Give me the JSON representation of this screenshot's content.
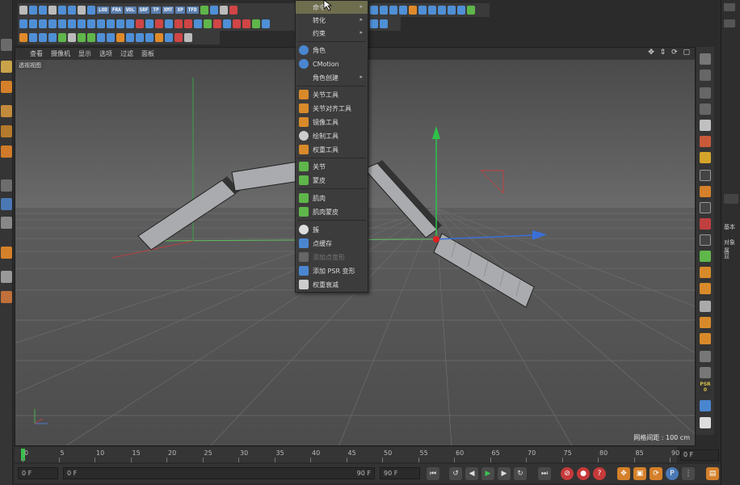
{
  "viewport": {
    "menu": [
      "查看",
      "摄像机",
      "显示",
      "选项",
      "过滤",
      "面板"
    ],
    "label": "透视视图",
    "grid_spacing": "网格间距 : 100 cm",
    "nav_icons": "✥ ⇕ ⟳ ▢"
  },
  "menu": {
    "items": [
      {
        "label": "命令",
        "icon": "none",
        "arrow": "▸",
        "state": "highlighted"
      },
      {
        "label": "转化",
        "icon": "none",
        "arrow": "▸"
      },
      {
        "label": "约束",
        "icon": "none",
        "arrow": "▸"
      },
      {
        "label": "角色",
        "icon": "character-icon",
        "color": "#4a86d0"
      },
      {
        "label": "CMotion",
        "icon": "cmotion-icon",
        "color": "#4a86d0"
      },
      {
        "label": "角色创建",
        "icon": "none",
        "arrow": "▸"
      },
      {
        "label": "关节工具",
        "icon": "joint-tool-icon",
        "color": "#d88a2a"
      },
      {
        "label": "关节对齐工具",
        "icon": "joint-align-icon",
        "color": "#d88a2a"
      },
      {
        "label": "镜像工具",
        "icon": "mirror-tool-icon",
        "color": "#d88a2a"
      },
      {
        "label": "绘制工具",
        "icon": "paint-tool-icon",
        "color": "#cccccc"
      },
      {
        "label": "权重工具",
        "icon": "weight-tool-icon",
        "color": "#d88a2a"
      },
      {
        "label": "关节",
        "icon": "joint-icon",
        "color": "#5fb64a"
      },
      {
        "label": "蒙皮",
        "icon": "skin-icon",
        "color": "#5fb64a"
      },
      {
        "label": "肌肉",
        "icon": "muscle-icon",
        "color": "#5fb64a"
      },
      {
        "label": "肌肉蒙皮",
        "icon": "muscle-skin-icon",
        "color": "#5fb64a"
      },
      {
        "label": "簇",
        "icon": "cluster-icon",
        "color": "#dddddd"
      },
      {
        "label": "点缓存",
        "icon": "point-cache-icon",
        "color": "#4a86d0"
      },
      {
        "label": "添加点变形",
        "icon": "add-point-morph-icon",
        "color": "#888888",
        "state": "disabled"
      },
      {
        "label": "添加 PSR 变形",
        "icon": "add-psr-morph-icon",
        "color": "#4a86d0"
      },
      {
        "label": "权重衰减",
        "icon": "weight-falloff-icon",
        "color": "#cccccc"
      }
    ]
  },
  "toolbar": {
    "tags": [
      "LOD",
      "FRA",
      "VOL",
      "SRF",
      "TP",
      "XMT",
      "XP",
      "TFD"
    ]
  },
  "timeline": {
    "ticks": [
      "0",
      "5",
      "10",
      "15",
      "20",
      "25",
      "30",
      "35",
      "40",
      "45",
      "50",
      "55",
      "60",
      "65",
      "70",
      "75",
      "80",
      "85",
      "90"
    ],
    "current_frame_field": "0 F"
  },
  "bottom": {
    "start_field": "0 F",
    "range_left": "0 F",
    "range_right": "90 F",
    "end_field": "90 F"
  },
  "side_panel": {
    "labels": [
      "基本",
      "对象属",
      "显"
    ]
  },
  "right_tools": {
    "psr_label": "PSR",
    "psr_value": "0"
  }
}
